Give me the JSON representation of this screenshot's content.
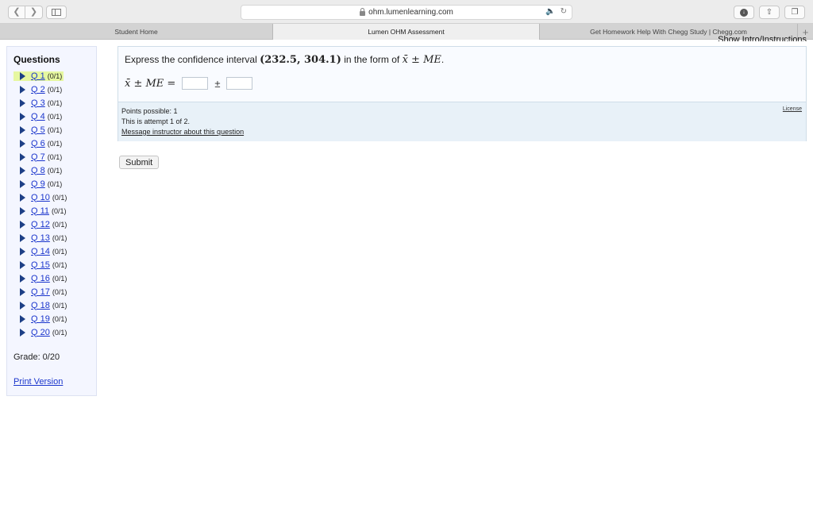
{
  "browser": {
    "url": "ohm.lumenlearning.com",
    "tabs": [
      {
        "label": "Student Home"
      },
      {
        "label": "Lumen OHM Assessment"
      },
      {
        "label": "Get Homework Help With Chegg Study | Chegg.com"
      }
    ],
    "new_tab_label": "+"
  },
  "sidebar": {
    "title": "Questions",
    "items": [
      {
        "label": "Q 1",
        "score": "(0/1)"
      },
      {
        "label": "Q 2",
        "score": "(0/1)"
      },
      {
        "label": "Q 3",
        "score": "(0/1)"
      },
      {
        "label": "Q 4",
        "score": "(0/1)"
      },
      {
        "label": "Q 5",
        "score": "(0/1)"
      },
      {
        "label": "Q 6",
        "score": "(0/1)"
      },
      {
        "label": "Q 7",
        "score": "(0/1)"
      },
      {
        "label": "Q 8",
        "score": "(0/1)"
      },
      {
        "label": "Q 9",
        "score": "(0/1)"
      },
      {
        "label": "Q 10",
        "score": "(0/1)"
      },
      {
        "label": "Q 11",
        "score": "(0/1)"
      },
      {
        "label": "Q 12",
        "score": "(0/1)"
      },
      {
        "label": "Q 13",
        "score": "(0/1)"
      },
      {
        "label": "Q 14",
        "score": "(0/1)"
      },
      {
        "label": "Q 15",
        "score": "(0/1)"
      },
      {
        "label": "Q 16",
        "score": "(0/1)"
      },
      {
        "label": "Q 17",
        "score": "(0/1)"
      },
      {
        "label": "Q 18",
        "score": "(0/1)"
      },
      {
        "label": "Q 19",
        "score": "(0/1)"
      },
      {
        "label": "Q 20",
        "score": "(0/1)"
      }
    ],
    "grade": "Grade: 0/20",
    "print_version": "Print Version"
  },
  "header": {
    "show_intro": "Show Intro/Instructions"
  },
  "question": {
    "prompt_prefix": "Express the confidence interval ",
    "interval": "(232.5, 304.1)",
    "prompt_middle": " in the form of ",
    "form": "x̄ ± ME",
    "prompt_end": ".",
    "answer_label": "x̄ ± ME =",
    "pm_symbol": "±",
    "answer_value_1": "",
    "answer_value_2": "",
    "points_possible": "Points possible: 1",
    "attempt": "This is attempt 1 of 2.",
    "message_link": "Message instructor about this question",
    "license": "License"
  },
  "actions": {
    "submit_label": "Submit"
  },
  "colors": {
    "link": "#1a35cc",
    "current_highlight": "#e6f7a0",
    "panel_bg": "#f4f6ff",
    "question_footer_bg": "#e8f1f8"
  }
}
